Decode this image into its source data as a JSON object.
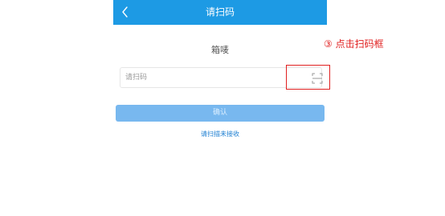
{
  "header": {
    "title": "请扫码",
    "back_icon": "chevron-left-icon",
    "color": "#1d9ae4"
  },
  "main": {
    "box_title": "箱唛",
    "scan_input": {
      "value": "",
      "placeholder": "请扫码",
      "scan_icon": "scan-frame-icon"
    },
    "confirm_label": "确认",
    "link_text": "请扫描未接收"
  },
  "annotation": {
    "step_text": "③ 点击扫码框",
    "color": "#e02020"
  }
}
